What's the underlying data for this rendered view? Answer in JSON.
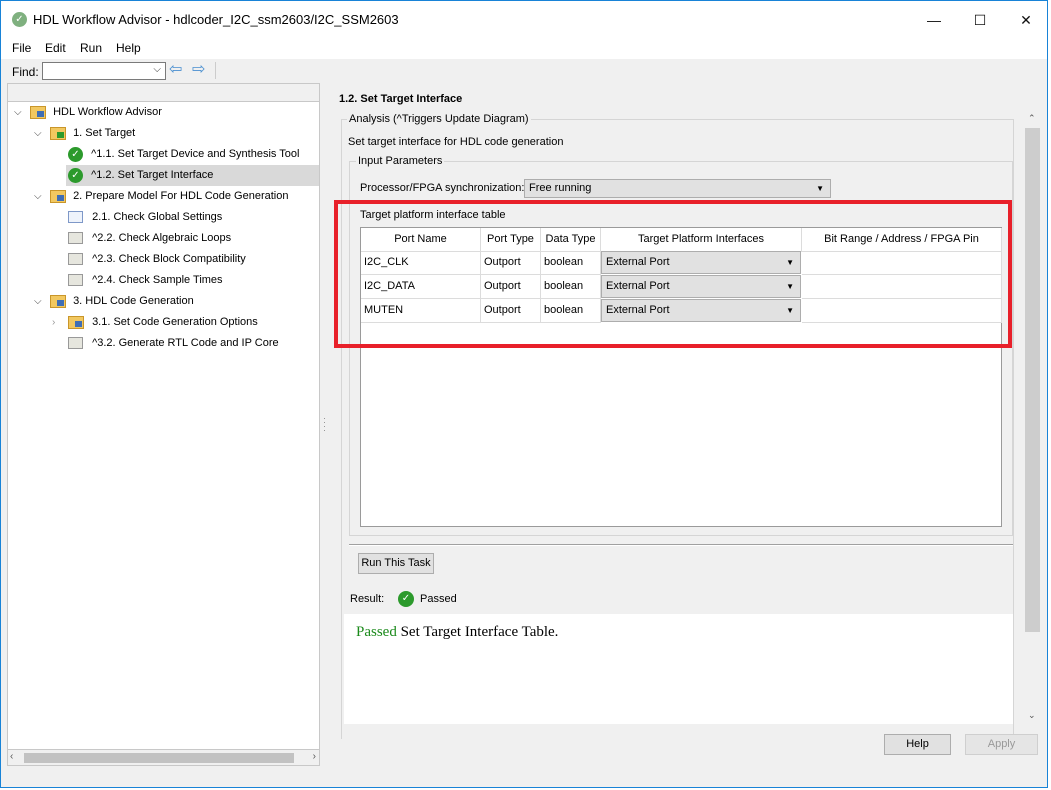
{
  "window": {
    "title": "HDL Workflow Advisor - hdlcoder_I2C_ssm2603/I2C_SSM2603",
    "controls": [
      "—",
      "☐",
      "✕"
    ]
  },
  "menu": [
    "File",
    "Edit",
    "Run",
    "Help"
  ],
  "toolbar": {
    "find_label": "Find:",
    "find_value": "",
    "back_icon": "arrow-left-icon",
    "forward_icon": "arrow-right-icon"
  },
  "tree": [
    {
      "label": "HDL Workflow Advisor",
      "icon": "folder",
      "expanded": true
    },
    {
      "label": "1. Set Target",
      "icon": "folder-check",
      "expanded": true
    },
    {
      "label": "^1.1. Set Target Device and Synthesis Tool",
      "icon": "check"
    },
    {
      "label": "^1.2. Set Target Interface",
      "icon": "check",
      "selected": true
    },
    {
      "label": "2. Prepare Model For HDL Code Generation",
      "icon": "folder",
      "expanded": true
    },
    {
      "label": "2.1. Check Global Settings",
      "icon": "list-blue"
    },
    {
      "label": "^2.2. Check Algebraic Loops",
      "icon": "list"
    },
    {
      "label": "^2.3. Check Block Compatibility",
      "icon": "list"
    },
    {
      "label": "^2.4. Check Sample Times",
      "icon": "list"
    },
    {
      "label": "3. HDL Code Generation",
      "icon": "folder",
      "expanded": true
    },
    {
      "label": "3.1. Set Code Generation Options",
      "icon": "folder",
      "expanded": false
    },
    {
      "label": "^3.2. Generate RTL Code and IP Core",
      "icon": "list"
    }
  ],
  "main": {
    "title": "1.2. Set Target Interface",
    "analysis_label": "Analysis (^Triggers Update Diagram)",
    "description": "Set target interface for HDL code generation",
    "input_params_label": "Input Parameters",
    "sync_label": "Processor/FPGA synchronization:",
    "sync_value": "Free running",
    "table_label": "Target platform interface table",
    "table": {
      "columns": [
        "Port Name",
        "Port Type",
        "Data Type",
        "Target Platform Interfaces",
        "Bit Range / Address / FPGA Pin"
      ],
      "rows": [
        [
          "I2C_CLK",
          "Outport",
          "boolean",
          "External Port",
          ""
        ],
        [
          "I2C_DATA",
          "Outport",
          "boolean",
          "External Port",
          ""
        ],
        [
          "MUTEN",
          "Outport",
          "boolean",
          "External Port",
          ""
        ]
      ]
    },
    "run_button": "Run This Task",
    "result_label": "Result:",
    "result_status": "Passed",
    "result_message_status": "Passed",
    "result_message": " Set Target Interface Table.",
    "highlight_color": "#e8202a",
    "pass_color": "#2c9a2c"
  },
  "footer": {
    "help": "Help",
    "apply": "Apply"
  }
}
